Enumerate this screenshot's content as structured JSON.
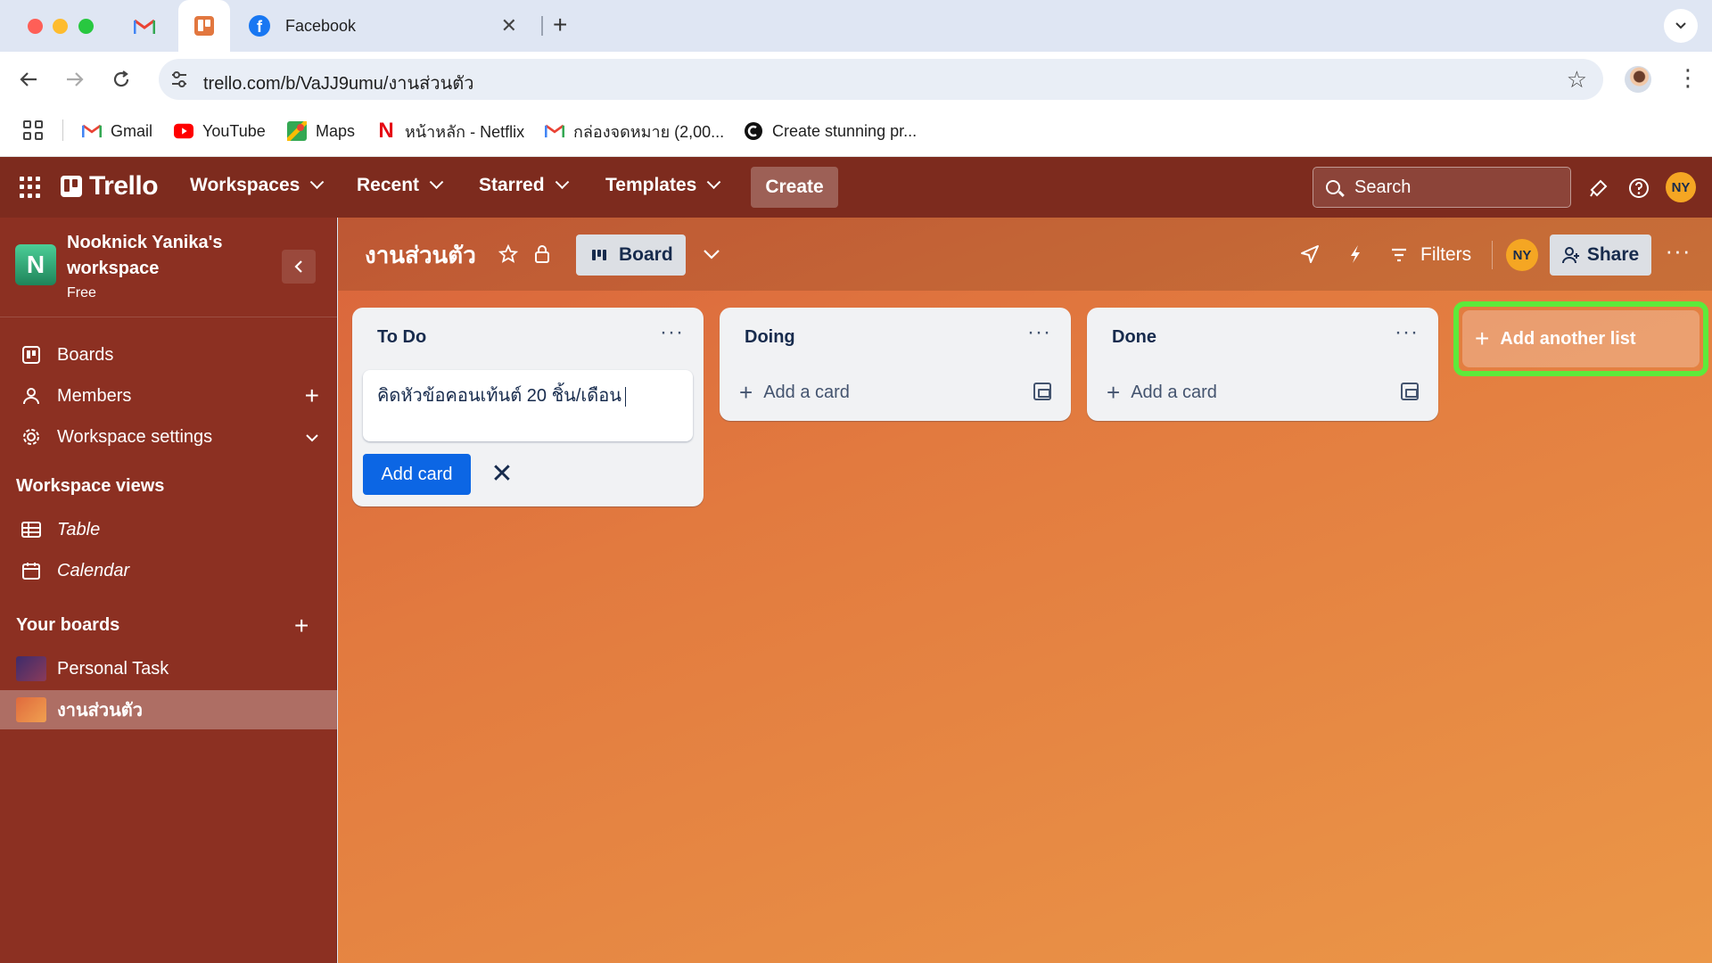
{
  "browser": {
    "tabs": [
      {
        "title": "Facebook"
      }
    ],
    "url": "trello.com/b/VaJJ9umu/งานส่วนตัว",
    "bookmarks": [
      {
        "label": "Gmail"
      },
      {
        "label": "YouTube"
      },
      {
        "label": "Maps"
      },
      {
        "label": "หน้าหลัก - Netflix"
      },
      {
        "label": "กล่องจดหมาย (2,00..."
      },
      {
        "label": "Create stunning pr..."
      }
    ]
  },
  "header": {
    "brand": "Trello",
    "menus": [
      "Workspaces",
      "Recent",
      "Starred",
      "Templates"
    ],
    "create_label": "Create",
    "search_placeholder": "Search",
    "avatar_initials": "NY"
  },
  "sidebar": {
    "workspace_initial": "N",
    "workspace_name": "Nooknick Yanika's workspace",
    "workspace_plan": "Free",
    "items": [
      {
        "label": "Boards"
      },
      {
        "label": "Members"
      },
      {
        "label": "Workspace settings"
      }
    ],
    "views_heading": "Workspace views",
    "views": [
      {
        "label": "Table"
      },
      {
        "label": "Calendar"
      }
    ],
    "boards_heading": "Your boards",
    "boards": [
      {
        "label": "Personal Task",
        "color": "#5b3b6b"
      },
      {
        "label": "งานส่วนตัว",
        "color": "#e2773f"
      }
    ]
  },
  "board": {
    "title": "งานส่วนตัว",
    "view_label": "Board",
    "filters_label": "Filters",
    "member_initials": "NY",
    "share_label": "Share",
    "lists": [
      {
        "title": "To Do",
        "composer_text": "คิดหัวข้อคอนเท้นต์ 20 ชิ้น/เดือน",
        "add_button": "Add card"
      },
      {
        "title": "Doing",
        "add_card": "Add a card"
      },
      {
        "title": "Done",
        "add_card": "Add a card"
      }
    ],
    "add_list_label": "Add another list",
    "highlight_color": "#5dea3a"
  }
}
